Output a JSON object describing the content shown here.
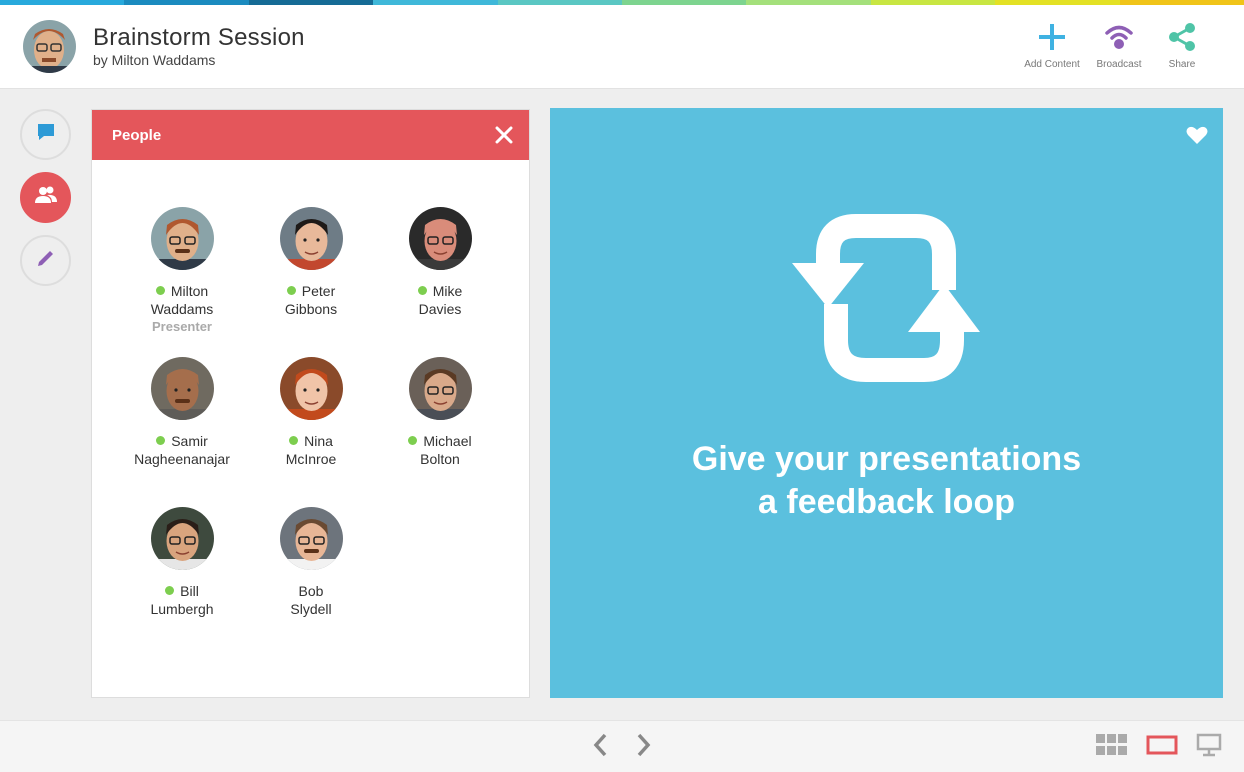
{
  "colors": {
    "stripe": [
      "#28a9dc",
      "#1b8bbf",
      "#156b95",
      "#3fb8d9",
      "#5ac7c3",
      "#7dd48f",
      "#a4e07b",
      "#c8e642",
      "#e3e124",
      "#f0c419"
    ],
    "accent_red": "#e4565b",
    "stage_blue": "#5bc0de",
    "online_green": "#7dce4f",
    "add_blue": "#3fb2e2",
    "broadcast_purple": "#8e5fb5",
    "share_teal": "#4fc4a7"
  },
  "header": {
    "title": "Brainstorm Session",
    "byline": "by Milton Waddams",
    "actions": [
      {
        "icon": "plus-icon",
        "label": "Add Content"
      },
      {
        "icon": "broadcast-icon",
        "label": "Broadcast"
      },
      {
        "icon": "share-icon",
        "label": "Share"
      }
    ]
  },
  "leftnav": [
    {
      "icon": "chat-bubble-icon",
      "active": false
    },
    {
      "icon": "people-icon",
      "active": true
    },
    {
      "icon": "pencil-icon",
      "active": false
    }
  ],
  "people_panel": {
    "title": "People",
    "people": [
      {
        "name_line1": "Milton",
        "name_line2": "Waddams",
        "role": "Presenter",
        "online": true
      },
      {
        "name_line1": "Peter",
        "name_line2": "Gibbons",
        "role": "",
        "online": true
      },
      {
        "name_line1": "Mike",
        "name_line2": "Davies",
        "role": "",
        "online": true
      },
      {
        "name_line1": "Samir",
        "name_line2": "Nagheenanajar",
        "role": "",
        "online": true
      },
      {
        "name_line1": "Nina",
        "name_line2": "McInroe",
        "role": "",
        "online": true
      },
      {
        "name_line1": "Michael",
        "name_line2": "Bolton",
        "role": "",
        "online": true
      },
      {
        "name_line1": "Bill",
        "name_line2": "Lumbergh",
        "role": "",
        "online": true
      },
      {
        "name_line1": "Bob",
        "name_line2": "Slydell",
        "role": "",
        "online": false
      }
    ]
  },
  "stage": {
    "line1": "Give your presentations",
    "line2": "a feedback loop",
    "icon": "refresh-loop-icon",
    "favorite_icon": "heart-icon"
  },
  "footer": {
    "prev_icon": "chevron-left-icon",
    "next_icon": "chevron-right-icon",
    "view_icons": [
      "grid-view-icon",
      "slide-view-icon",
      "presenter-view-icon"
    ]
  }
}
